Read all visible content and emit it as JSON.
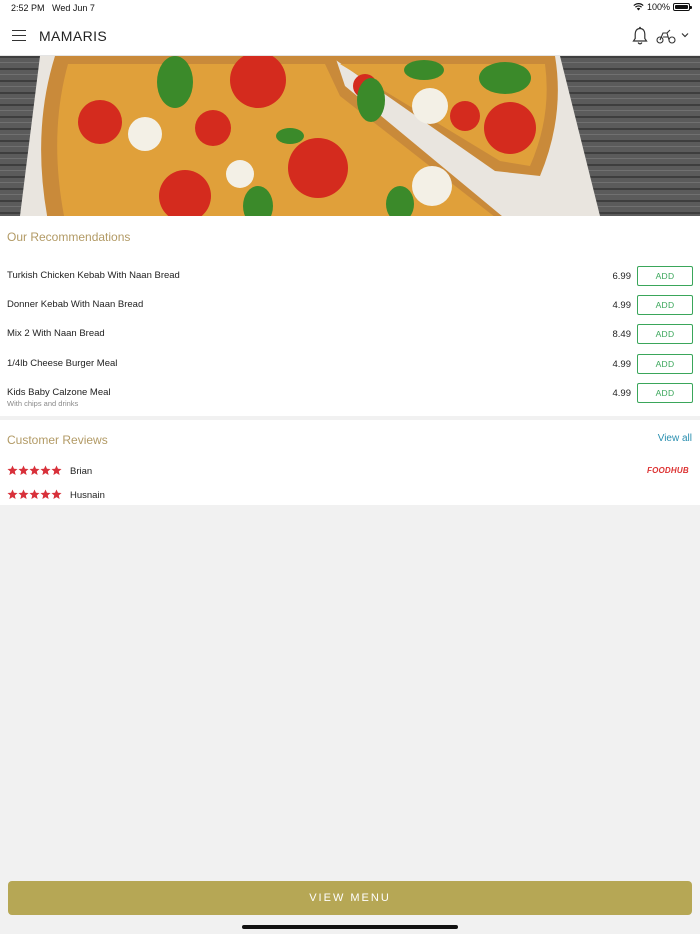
{
  "status_bar": {
    "time": "2:52 PM",
    "date": "Wed Jun 7",
    "battery": "100%"
  },
  "header": {
    "title": "MAMARIS"
  },
  "icons": {
    "menu": "hamburger-menu-icon",
    "bell": "bell-icon",
    "delivery": "scooter-icon",
    "dropdown": "chevron-down-icon"
  },
  "recommendations": {
    "title": "Our Recommendations",
    "add_label": "ADD",
    "items": [
      {
        "name": "Turkish Chicken Kebab With Naan Bread",
        "sub": "",
        "price": "6.99"
      },
      {
        "name": "Donner Kebab With Naan Bread",
        "sub": "",
        "price": "4.99"
      },
      {
        "name": "Mix 2 With Naan Bread",
        "sub": "",
        "price": "8.49"
      },
      {
        "name": "1/4lb Cheese Burger Meal",
        "sub": "",
        "price": "4.99"
      },
      {
        "name": "Kids Baby Calzone Meal",
        "sub": "With chips and drinks",
        "price": "4.99"
      }
    ]
  },
  "reviews": {
    "title": "Customer Reviews",
    "view_all": "View all",
    "source_logo": "FOODHUB",
    "items": [
      {
        "name": "Brian",
        "rating": 5
      },
      {
        "name": "Husnain",
        "rating": 5
      }
    ]
  },
  "footer": {
    "view_menu_label": "VIEW MENU"
  },
  "colors": {
    "accent_gold": "#b6a755",
    "section_title": "#b29a65",
    "add_green": "#3aa65a",
    "link_blue": "#2a8fb0",
    "star_red": "#d8303a"
  }
}
